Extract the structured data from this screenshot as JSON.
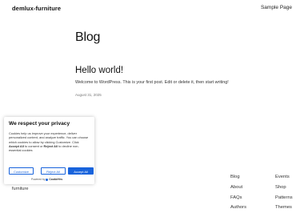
{
  "header": {
    "site_title": "demlux-furniture",
    "nav_item": "Sample Page"
  },
  "main": {
    "page_title": "Blog",
    "post": {
      "title": "Hello world!",
      "excerpt": "Welcome to WordPress. This is your first post. Edit or delete it, then start writing!",
      "date": "August 31, 2025"
    }
  },
  "footer": {
    "brand": "furniture",
    "col1": [
      "Blog",
      "About",
      "FAQs",
      "Authors"
    ],
    "col2": [
      "Events",
      "Shop",
      "Patterns",
      "Themes"
    ]
  },
  "cookie_banner": {
    "title": "We respect your privacy",
    "text_part1": "Cookies help us improve your experience, deliver personalized content, and analyze traffic. You can choose which cookies to allow by clicking ",
    "text_customize": "Customize",
    "text_part2": ". Click ",
    "text_accept_all": "Accept All",
    "text_part3": " to consent or ",
    "text_reject_all": "Reject All",
    "text_part4": " to decline non-essential cookies",
    "btn_customize": "Customize",
    "btn_reject": "Reject All",
    "btn_accept": "Accept All",
    "powered_by": "Powered by",
    "powered_brand": "CookieYes",
    "accent_color": "#1863dc"
  }
}
